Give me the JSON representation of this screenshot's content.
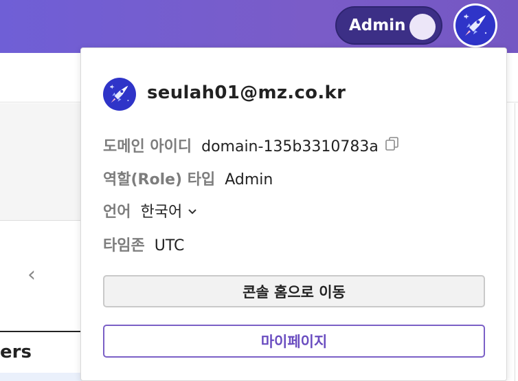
{
  "topbar": {
    "role_toggle_label": "Admin",
    "accent_color": "#7a5cc8"
  },
  "background": {
    "truncated_text": "ers"
  },
  "profile_menu": {
    "email": "seulah01@mz.co.kr",
    "avatar_icon": "rocket-icon",
    "fields": {
      "domain_id": {
        "label": "도메인 아이디",
        "value": "domain-135b3310783a"
      },
      "role_type": {
        "label": "역할(Role) 타입",
        "value": "Admin"
      },
      "language": {
        "label": "언어",
        "value": "한국어"
      },
      "timezone": {
        "label": "타임존",
        "value": "UTC"
      }
    },
    "buttons": {
      "console_home": "콘솔 홈으로 이동",
      "my_page": "마이페이지"
    }
  }
}
